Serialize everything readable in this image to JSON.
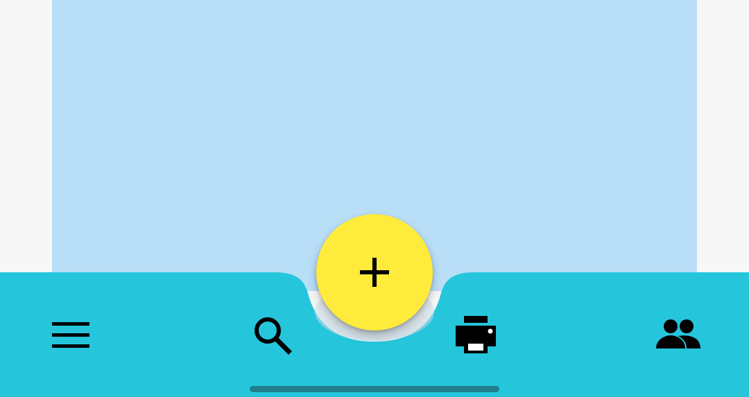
{
  "colors": {
    "page_background": "#f7f7f7",
    "content_background": "#b9def7",
    "bottom_bar": "#25c6dc",
    "fab_background": "#ffeb3b",
    "icon": "#000000",
    "home_indicator": "#1f7f8d"
  },
  "bottom_app_bar": {
    "items": [
      {
        "name": "menu",
        "icon": "menu-icon"
      },
      {
        "name": "search",
        "icon": "search-icon"
      },
      {
        "name": "print",
        "icon": "print-icon"
      },
      {
        "name": "people",
        "icon": "people-icon"
      }
    ],
    "fab": {
      "name": "add",
      "icon": "plus-icon"
    }
  }
}
